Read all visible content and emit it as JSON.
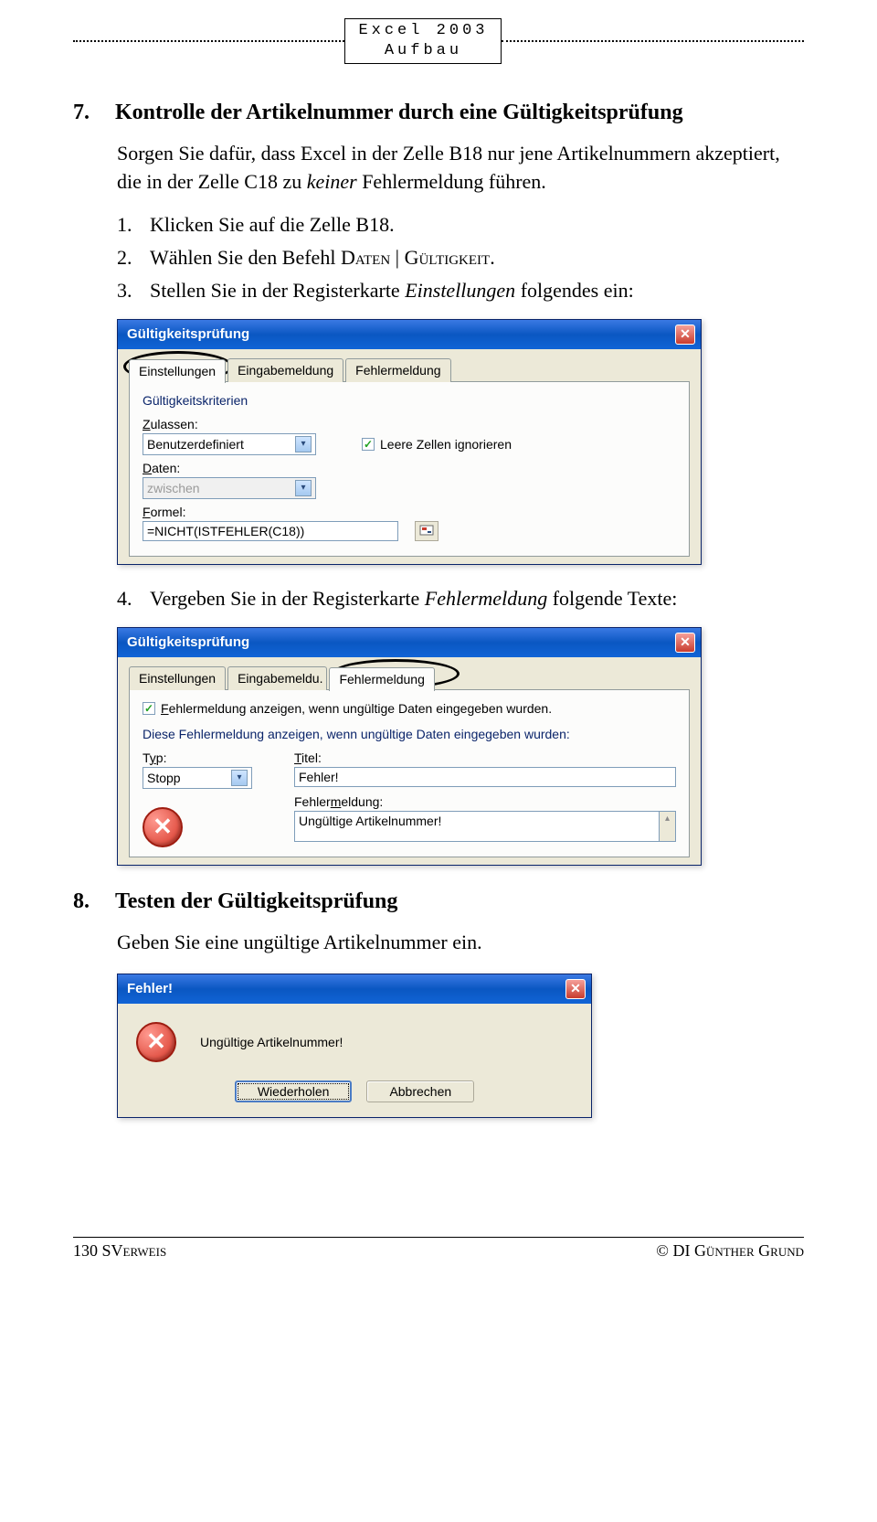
{
  "header": {
    "line1": "Excel 2003",
    "line2": "Aufbau"
  },
  "section7": {
    "num": "7.",
    "title": "Kontrolle der Artikelnummer durch eine Gültigkeitsprüfung",
    "intro_a": "Sorgen Sie dafür, dass Excel in der Zelle B18 nur jene Artikelnummern akzeptiert, die in der Zelle C18 zu ",
    "intro_ital": "keiner",
    "intro_b": " Fehlermeldung führen.",
    "steps": [
      {
        "n": "1.",
        "text": "Klicken Sie auf die Zelle B18."
      },
      {
        "n": "2.",
        "text_a": "Wählen Sie den Befehl ",
        "sc1": "Daten",
        "sep": " | ",
        "sc2": "Gültigkeit",
        "tail": "."
      },
      {
        "n": "3.",
        "text_a": "Stellen Sie in der Registerkarte ",
        "ital": "Einstellungen",
        "text_b": " folgendes ein:"
      }
    ],
    "step4": {
      "n": "4.",
      "text_a": "Vergeben Sie in der Registerkarte ",
      "ital": "Fehlermeldung",
      "text_b": " folgende Texte:"
    }
  },
  "dlg1": {
    "title": "Gültigkeitsprüfung",
    "tabs": [
      "Einstellungen",
      "Eingabemeldung",
      "Fehlermeldung"
    ],
    "group": "Gültigkeitskriterien",
    "lbl_zulassen": "Zulassen:",
    "val_zulassen": "Benutzerdefiniert",
    "chk_leere": "Leere Zellen ignorieren",
    "lbl_daten": "Daten:",
    "val_daten": "zwischen",
    "lbl_formel": "Formel:",
    "val_formel": "=NICHT(ISTFEHLER(C18))"
  },
  "dlg2": {
    "title": "Gültigkeitsprüfung",
    "tabs": [
      "Einstellungen",
      "Eingabemeldu.",
      "Fehlermeldung"
    ],
    "chk_show": "Fehlermeldung anzeigen, wenn ungültige Daten eingegeben wurden.",
    "hint": "Diese Fehlermeldung anzeigen, wenn ungültige Daten eingegeben wurden:",
    "lbl_typ": "Typ:",
    "val_typ": "Stopp",
    "lbl_titel": "Titel:",
    "val_titel": "Fehler!",
    "lbl_msg": "Fehlermeldung:",
    "val_msg": "Ungültige Artikelnummer!"
  },
  "section8": {
    "num": "8.",
    "title": "Testen der Gültigkeitsprüfung",
    "text": "Geben Sie eine ungültige Artikelnummer ein."
  },
  "msgbox": {
    "title": "Fehler!",
    "text": "Ungültige Artikelnummer!",
    "btn1": "Wiederholen",
    "btn2": "Abbrechen"
  },
  "footer": {
    "left_a": "130  ",
    "left_sc": "SVerweis",
    "right_a": "© DI ",
    "right_sc": "Günther Grund"
  }
}
